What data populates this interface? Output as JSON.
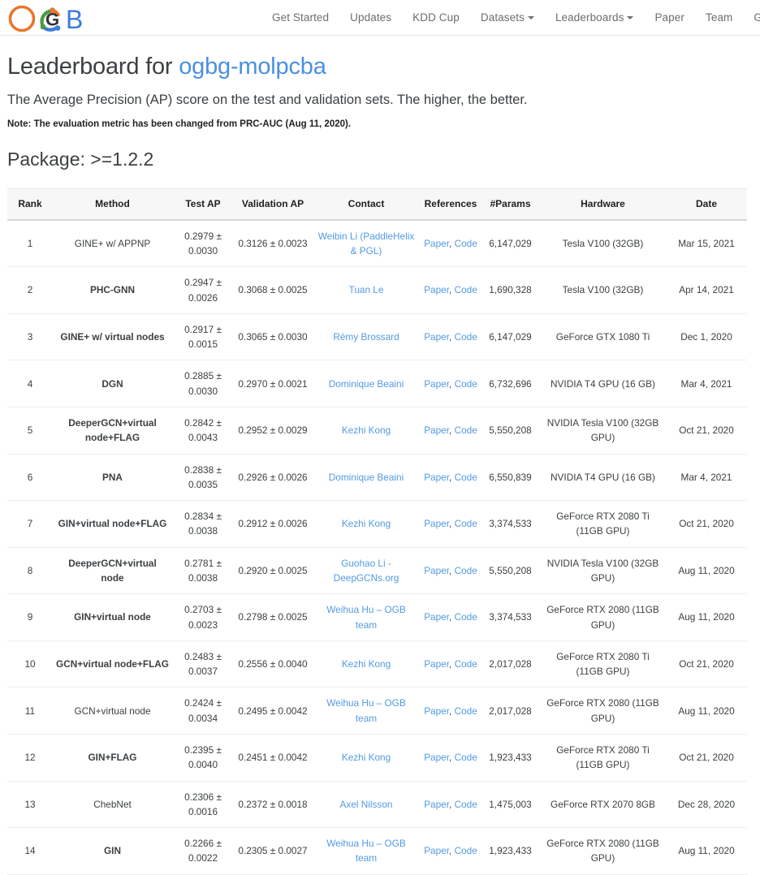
{
  "nav": {
    "logo_alt": "OGB",
    "items": [
      {
        "label": "Get Started",
        "has_caret": false
      },
      {
        "label": "Updates",
        "has_caret": false
      },
      {
        "label": "KDD Cup",
        "has_caret": false
      },
      {
        "label": "Datasets",
        "has_caret": true
      },
      {
        "label": "Leaderboards",
        "has_caret": true
      },
      {
        "label": "Paper",
        "has_caret": false
      },
      {
        "label": "Team",
        "has_caret": false
      },
      {
        "label": "Github",
        "has_caret": false
      }
    ]
  },
  "header": {
    "title_prefix": "Leaderboard for ",
    "dataset_name": "ogbg-molpcba",
    "subtitle": "The Average Precision (AP) score on the test and validation sets. The higher, the better.",
    "note": "Note: The evaluation metric has been changed from PRC-AUC (Aug 11, 2020).",
    "package": "Package: >=1.2.2"
  },
  "colors": {
    "link": "#539ae2",
    "title_link": "#4a90e2",
    "text": "#3c4043",
    "header_bg": "#f7f7f7",
    "logo_orange": "#e8762c",
    "logo_green": "#4a9a46",
    "logo_blue": "#3b7dd8",
    "logo_dark": "#333333"
  },
  "table": {
    "columns": [
      "Rank",
      "Method",
      "Test AP",
      "Validation AP",
      "Contact",
      "References",
      "#Params",
      "Hardware",
      "Date"
    ],
    "reference_labels": [
      "Paper",
      "Code"
    ],
    "rows": [
      {
        "rank": "1",
        "method": "GINE+ w/ APPNP",
        "method_bold": false,
        "test_ap": "0.2979 ± 0.0030",
        "validation_ap": "0.3126 ± 0.0023",
        "contact": "Weibin Li (PaddleHelix & PGL)",
        "params": "6,147,029",
        "hardware": "Tesla V100 (32GB)",
        "date": "Mar 15, 2021"
      },
      {
        "rank": "2",
        "method": "PHC-GNN",
        "method_bold": true,
        "test_ap": "0.2947 ± 0.0026",
        "validation_ap": "0.3068 ± 0.0025",
        "contact": "Tuan Le",
        "params": "1,690,328",
        "hardware": "Tesla V100 (32GB)",
        "date": "Apr 14, 2021"
      },
      {
        "rank": "3",
        "method": "GINE+ w/ virtual nodes",
        "method_bold": true,
        "test_ap": "0.2917 ± 0.0015",
        "validation_ap": "0.3065 ± 0.0030",
        "contact": "Rémy Brossard",
        "params": "6,147,029",
        "hardware": "GeForce GTX 1080 Ti",
        "date": "Dec 1, 2020"
      },
      {
        "rank": "4",
        "method": "DGN",
        "method_bold": true,
        "test_ap": "0.2885 ± 0.0030",
        "validation_ap": "0.2970 ± 0.0021",
        "contact": "Dominique Beaini",
        "params": "6,732,696",
        "hardware": "NVIDIA T4 GPU (16 GB)",
        "date": "Mar 4, 2021"
      },
      {
        "rank": "5",
        "method": "DeeperGCN+virtual node+FLAG",
        "method_bold": true,
        "test_ap": "0.2842 ± 0.0043",
        "validation_ap": "0.2952 ± 0.0029",
        "contact": "Kezhi Kong",
        "params": "5,550,208",
        "hardware": "NVIDIA Tesla V100 (32GB GPU)",
        "date": "Oct 21, 2020"
      },
      {
        "rank": "6",
        "method": "PNA",
        "method_bold": true,
        "test_ap": "0.2838 ± 0.0035",
        "validation_ap": "0.2926 ± 0.0026",
        "contact": "Dominique Beaini",
        "params": "6,550,839",
        "hardware": "NVIDIA T4 GPU (16 GB)",
        "date": "Mar 4, 2021"
      },
      {
        "rank": "7",
        "method": "GIN+virtual node+FLAG",
        "method_bold": true,
        "test_ap": "0.2834 ± 0.0038",
        "validation_ap": "0.2912 ± 0.0026",
        "contact": "Kezhi Kong",
        "params": "3,374,533",
        "hardware": "GeForce RTX 2080 Ti (11GB GPU)",
        "date": "Oct 21, 2020"
      },
      {
        "rank": "8",
        "method": "DeeperGCN+virtual node",
        "method_bold": true,
        "test_ap": "0.2781 ± 0.0038",
        "validation_ap": "0.2920 ± 0.0025",
        "contact": "Guohao Li - DeepGCNs.org",
        "params": "5,550,208",
        "hardware": "NVIDIA Tesla V100 (32GB GPU)",
        "date": "Aug 11, 2020"
      },
      {
        "rank": "9",
        "method": "GIN+virtual node",
        "method_bold": true,
        "test_ap": "0.2703 ± 0.0023",
        "validation_ap": "0.2798 ± 0.0025",
        "contact": "Weihua Hu – OGB team",
        "params": "3,374,533",
        "hardware": "GeForce RTX 2080 (11GB GPU)",
        "date": "Aug 11, 2020"
      },
      {
        "rank": "10",
        "method": "GCN+virtual node+FLAG",
        "method_bold": true,
        "test_ap": "0.2483 ± 0.0037",
        "validation_ap": "0.2556 ± 0.0040",
        "contact": "Kezhi Kong",
        "params": "2,017,028",
        "hardware": "GeForce RTX 2080 Ti (11GB GPU)",
        "date": "Oct 21, 2020"
      },
      {
        "rank": "11",
        "method": "GCN+virtual node",
        "method_bold": false,
        "test_ap": "0.2424 ± 0.0034",
        "validation_ap": "0.2495 ± 0.0042",
        "contact": "Weihua Hu – OGB team",
        "params": "2,017,028",
        "hardware": "GeForce RTX 2080 (11GB GPU)",
        "date": "Aug 11, 2020"
      },
      {
        "rank": "12",
        "method": "GIN+FLAG",
        "method_bold": true,
        "test_ap": "0.2395 ± 0.0040",
        "validation_ap": "0.2451 ± 0.0042",
        "contact": "Kezhi Kong",
        "params": "1,923,433",
        "hardware": "GeForce RTX 2080 Ti (11GB GPU)",
        "date": "Oct 21, 2020"
      },
      {
        "rank": "13",
        "method": "ChebNet",
        "method_bold": false,
        "test_ap": "0.2306 ± 0.0016",
        "validation_ap": "0.2372 ± 0.0018",
        "contact": "Axel Nilsson",
        "params": "1,475,003",
        "hardware": "GeForce RTX 2070 8GB",
        "date": "Dec 28, 2020"
      },
      {
        "rank": "14",
        "method": "GIN",
        "method_bold": true,
        "test_ap": "0.2266 ± 0.0022",
        "validation_ap": "0.2305 ± 0.0027",
        "contact": "Weihua Hu – OGB team",
        "params": "1,923,433",
        "hardware": "GeForce RTX 2080 (11GB GPU)",
        "date": "Aug 11, 2020"
      }
    ]
  }
}
